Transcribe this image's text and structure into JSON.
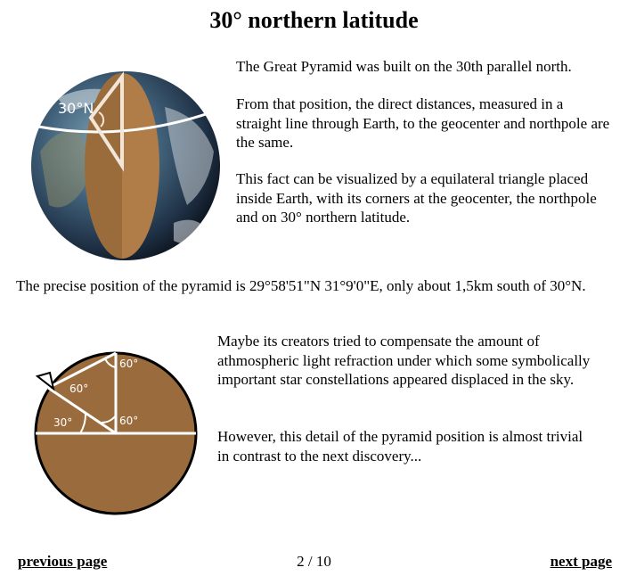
{
  "page": {
    "title": "30° northern latitude"
  },
  "globe": {
    "label": "30°N"
  },
  "paragraphs": {
    "p1": "The Great Pyramid was built on the 30th parallel north.",
    "p2": "From that position, the direct distances, measured in a straight line through Earth, to the geocenter and northpole are the same.",
    "p3": "This fact can be visualized by a equilateral triangle placed inside Earth, with its corners at the geocenter, the northpole and on 30° northern latitude.",
    "p4": "The precise position of the pyramid is 29°58'51\"N 31°9'0\"E, only about 1,5km south of 30°N.",
    "p5": "Maybe its creators tried to compensate the amount of athmospheric light refraction under which some symbolically important star constellations appeared displaced in the sky.",
    "p6": "However, this detail of the pyramid position is almost trivial in contrast to the next discovery..."
  },
  "diagram": {
    "angle_top": "60°",
    "angle_left": "60°",
    "angle_latitude": "30°",
    "angle_center": "60°"
  },
  "nav": {
    "previous": "previous page",
    "next": "next page",
    "pager": "2 / 10"
  }
}
